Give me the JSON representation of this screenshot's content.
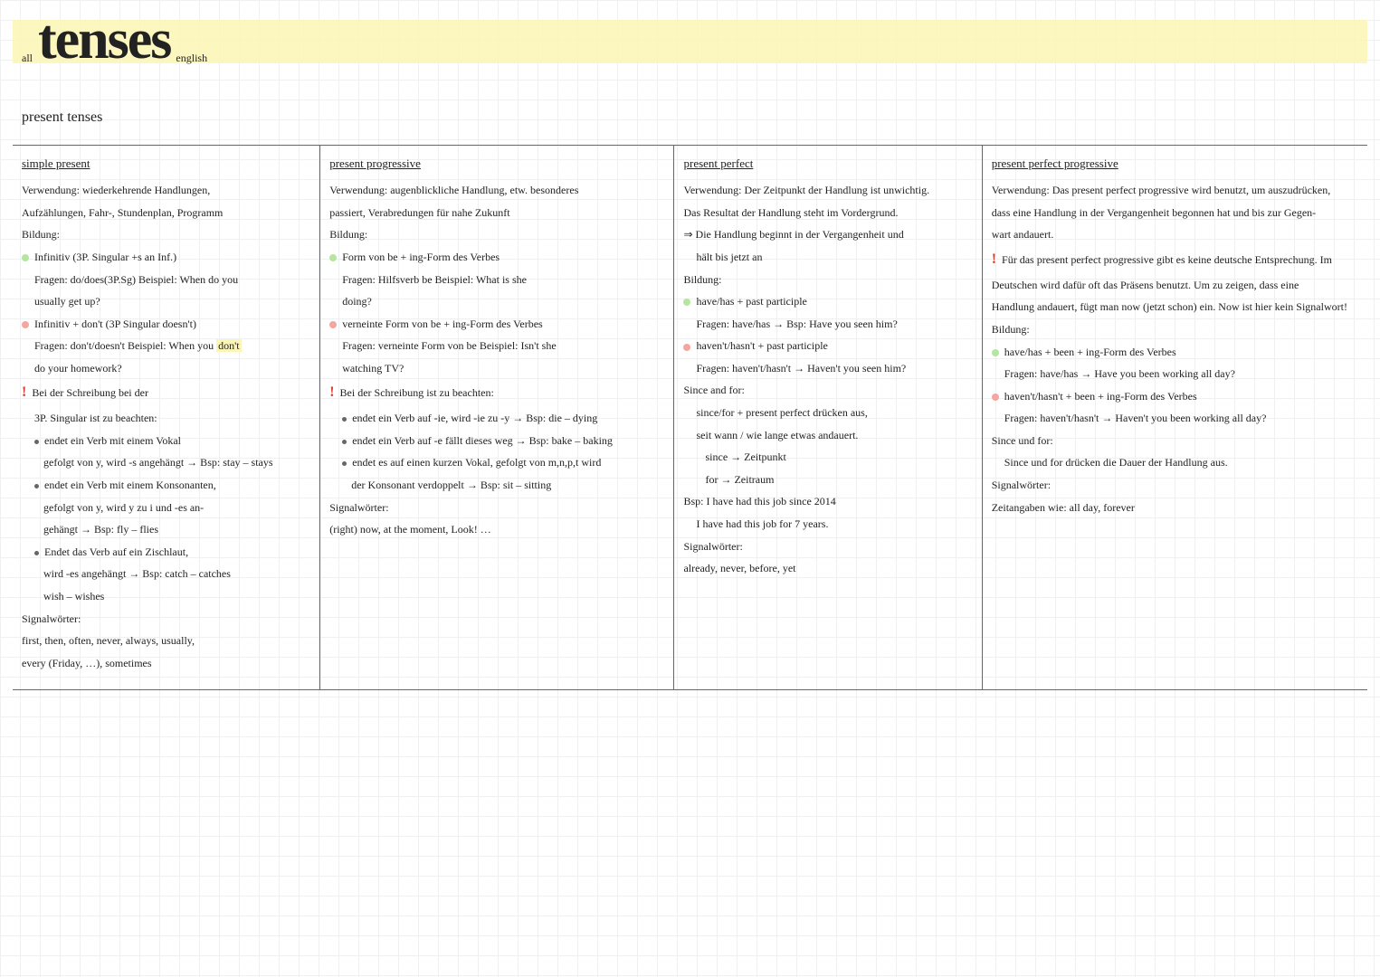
{
  "header": {
    "pre": "all",
    "title": "tenses",
    "post": "english"
  },
  "section": "present tenses",
  "cols": [
    {
      "title": "simple present",
      "lines": [
        {
          "t": "Verwendung: wiederkehrende Handlungen,"
        },
        {
          "t": "Aufzählungen, Fahr-, Stundenplan, Programm"
        },
        {
          "t": "Bildung:"
        },
        {
          "t": "Infinitiv (3P. Singular +s an Inf.)",
          "c": "dot-green"
        },
        {
          "t": "Fragen: do/does(3P.Sg)   Beispiel: When do you",
          "c": "sub"
        },
        {
          "t": "usually get up?",
          "c": "sub"
        },
        {
          "t": "Infinitiv + don't (3P Singular doesn't)",
          "c": "dot-red"
        },
        {
          "t": "Fragen: don't/doesn't   Beispiel: When you ",
          "c": "sub",
          "hl": "don't"
        },
        {
          "t": "do your homework?",
          "c": "sub"
        },
        {
          "t": "Bei der Schreibung bei der",
          "c": "bang"
        },
        {
          "t": "3P. Singular ist zu beachten:",
          "c": "sub"
        },
        {
          "t": "endet ein Verb mit einem Vokal",
          "c": "sub dot-bullet"
        },
        {
          "t": "gefolgt von y, wird -s angehängt → Bsp: stay – stays",
          "c": "sub2"
        },
        {
          "t": "endet ein Verb mit einem Konsonanten,",
          "c": "sub dot-bullet"
        },
        {
          "t": "gefolgt von y, wird y zu i und -es an-",
          "c": "sub2"
        },
        {
          "t": "gehängt → Bsp: fly – flies",
          "c": "sub2"
        },
        {
          "t": "Endet das Verb auf ein Zischlaut,",
          "c": "sub dot-bullet"
        },
        {
          "t": "wird -es angehängt → Bsp: catch – catches",
          "c": "sub2"
        },
        {
          "t": "wish – wishes",
          "c": "sub2"
        },
        {
          "t": "Signalwörter:"
        },
        {
          "t": "first, then, often, never, always, usually,"
        },
        {
          "t": "every (Friday, …), sometimes"
        }
      ]
    },
    {
      "title": "present progressive",
      "lines": [
        {
          "t": "Verwendung: augenblickliche Handlung, etw. besonderes"
        },
        {
          "t": "passiert, Verabredungen für nahe Zukunft"
        },
        {
          "t": "Bildung:"
        },
        {
          "t": "Form von be + ing-Form des Verbes",
          "c": "dot-green"
        },
        {
          "t": "Fragen: Hilfsverb be   Beispiel: What is she",
          "c": "sub"
        },
        {
          "t": "doing?",
          "c": "sub"
        },
        {
          "t": "verneinte Form von be + ing-Form des Verbes",
          "c": "dot-red"
        },
        {
          "t": "Fragen: verneinte Form von be   Beispiel: Isn't she",
          "c": "sub"
        },
        {
          "t": "watching TV?",
          "c": "sub"
        },
        {
          "t": "Bei der Schreibung ist zu beachten:",
          "c": "bang"
        },
        {
          "t": "endet ein Verb auf -ie, wird -ie zu -y → Bsp: die – dying",
          "c": "sub dot-bullet"
        },
        {
          "t": "endet ein Verb auf -e fällt dieses weg → Bsp: bake – baking",
          "c": "sub dot-bullet"
        },
        {
          "t": "endet es auf einen kurzen Vokal, gefolgt von m,n,p,t wird",
          "c": "sub dot-bullet"
        },
        {
          "t": "der Konsonant verdoppelt → Bsp: sit – sitting",
          "c": "sub2"
        },
        {
          "t": "Signalwörter:"
        },
        {
          "t": "(right) now, at the moment, Look! …"
        }
      ]
    },
    {
      "title": "present perfect",
      "lines": [
        {
          "t": "Verwendung: Der Zeitpunkt der Handlung ist unwichtig."
        },
        {
          "t": "Das Resultat der Handlung steht im Vordergrund."
        },
        {
          "t": "⇒ Die Handlung beginnt in der Vergangenheit und"
        },
        {
          "t": "hält bis jetzt an",
          "c": "sub"
        },
        {
          "t": "Bildung:"
        },
        {
          "t": "have/has + past participle",
          "c": "dot-green"
        },
        {
          "t": "Fragen: have/has → Bsp: Have you seen him?",
          "c": "sub"
        },
        {
          "t": "haven't/hasn't + past participle",
          "c": "dot-red"
        },
        {
          "t": "Fragen: haven't/hasn't → Haven't you seen him?",
          "c": "sub"
        },
        {
          "t": "Since and for:"
        },
        {
          "t": "since/for + present perfect drücken aus,",
          "c": "sub"
        },
        {
          "t": "seit wann / wie lange etwas andauert.",
          "c": "sub"
        },
        {
          "t": "since → Zeitpunkt",
          "c": "sub2"
        },
        {
          "t": "for → Zeitraum",
          "c": "sub2"
        },
        {
          "t": "Bsp: I have had this job since 2014"
        },
        {
          "t": "I have had this job for 7 years.",
          "c": "sub"
        },
        {
          "t": "Signalwörter:"
        },
        {
          "t": "already, never, before, yet"
        }
      ]
    },
    {
      "title": "present perfect progressive",
      "lines": [
        {
          "t": "Verwendung: Das present perfect progressive wird benutzt, um auszudrücken,"
        },
        {
          "t": "dass eine Handlung in der Vergangenheit begonnen hat und bis zur Gegen-"
        },
        {
          "t": "wart andauert."
        },
        {
          "t": "Für das present perfect progressive gibt es keine deutsche Entsprechung. Im",
          "c": "bang"
        },
        {
          "t": "Deutschen wird dafür oft das Präsens benutzt. Um zu zeigen, dass eine"
        },
        {
          "t": "Handlung andauert, fügt man now (jetzt schon) ein. Now ist hier kein Signalwort!"
        },
        {
          "t": "Bildung:"
        },
        {
          "t": "have/has + been + ing-Form des Verbes",
          "c": "dot-green"
        },
        {
          "t": "Fragen: have/has → Have you been working all day?",
          "c": "sub"
        },
        {
          "t": "haven't/hasn't + been + ing-Form des Verbes",
          "c": "dot-red"
        },
        {
          "t": "Fragen: haven't/hasn't → Haven't you been working all day?",
          "c": "sub"
        },
        {
          "t": "Since und for:"
        },
        {
          "t": "Since und for drücken die Dauer der Handlung aus.",
          "c": "sub"
        },
        {
          "t": "Signalwörter:"
        },
        {
          "t": "Zeitangaben wie: all day, forever"
        }
      ]
    }
  ]
}
